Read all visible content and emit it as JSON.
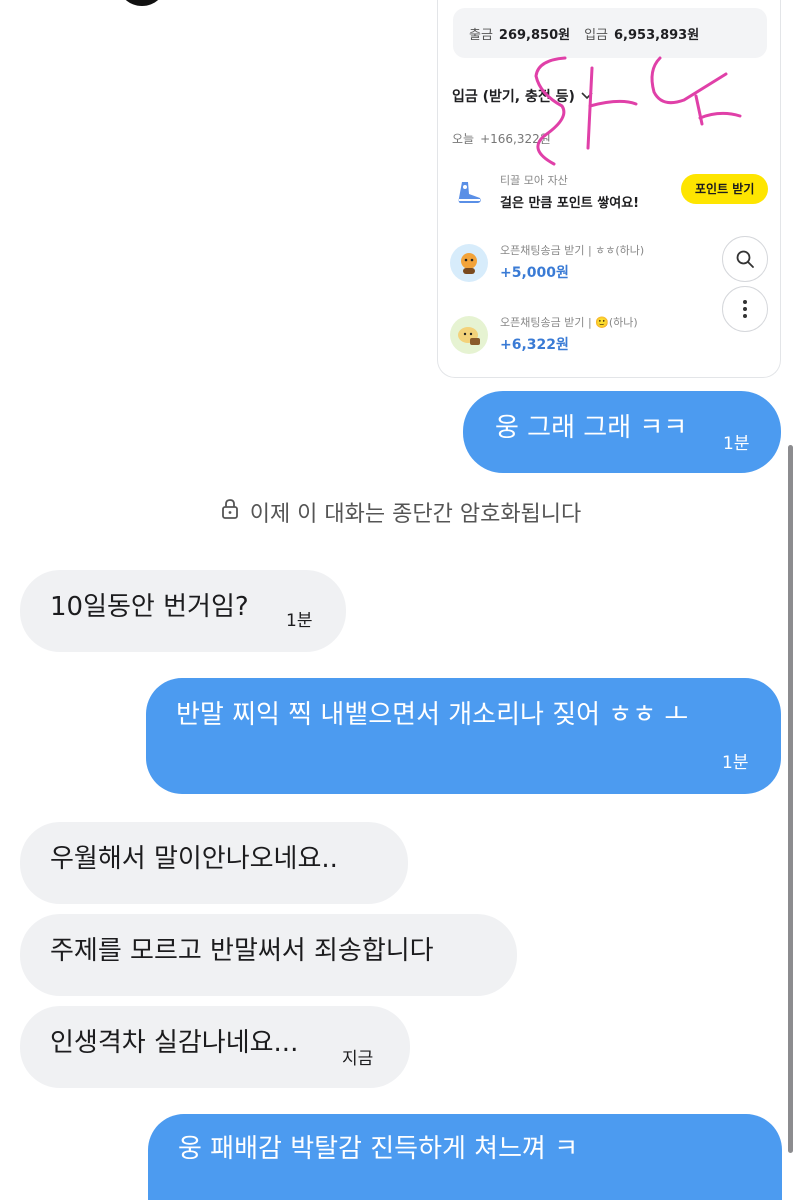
{
  "card": {
    "summary": {
      "out_label": "출금",
      "out_value": "269,850원",
      "in_label": "입금",
      "in_value": "6,953,893원"
    },
    "filter_label": "입금 (받기, 충전 등)",
    "today_label": "오늘",
    "today_amount": "+166,322원",
    "promo": {
      "sub": "티끌 모아 자산",
      "main": "걸은 만큼 포인트 쌓여요!",
      "button": "포인트 받기"
    },
    "transactions": [
      {
        "sub": "오픈채팅송금 받기 | ㅎㅎ(하나)",
        "amount": "+5,000원"
      },
      {
        "sub": "오픈채팅송금 받기 | 🙂(하나)",
        "amount": "+6,322원"
      }
    ]
  },
  "notice": "이제 이 대화는 종단간 암호화됩니다",
  "messages": [
    {
      "text": "웅 그래 그래 ㅋㅋ",
      "time": "1분"
    },
    {
      "text": "10일동안 번거임?",
      "time": "1분"
    },
    {
      "text": "반말 찌익 찍 내뱉으면서 개소리나 짖어 ㅎㅎ ㅗ",
      "time": "1분"
    },
    {
      "text": "우월해서 말이안나오네요.."
    },
    {
      "text": "주제를 모르고 반말써서 죄송합니다"
    },
    {
      "text": "인생격차 실감나네요...",
      "time": "지금"
    },
    {
      "text": "웅 패배감 박탈감 진득하게 쳐느껴 ㅋ"
    }
  ],
  "colors": {
    "sent_bubble": "#4c9bf0",
    "recv_bubble": "#f0f1f3",
    "point_button": "#fee500",
    "amount_blue": "#3a7bd5",
    "scribble": "#e040a8"
  }
}
